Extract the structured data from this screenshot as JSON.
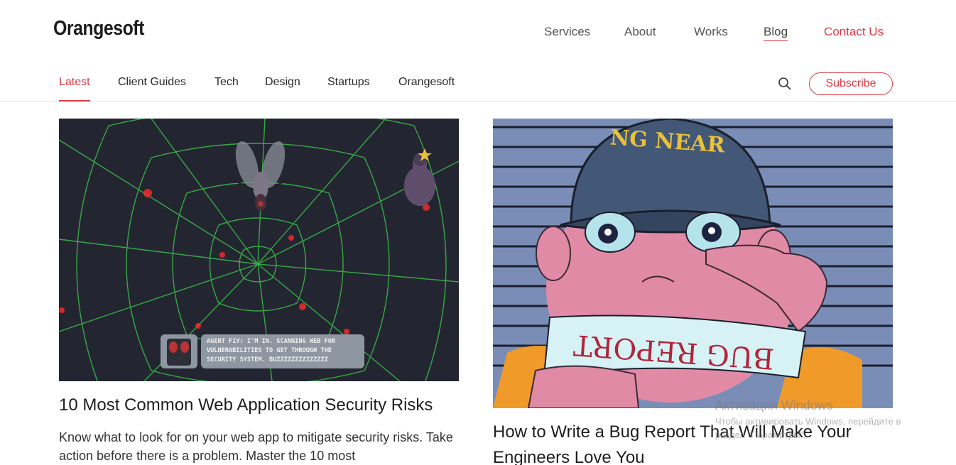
{
  "brand": {
    "name": "Orangesoft"
  },
  "main_nav": [
    {
      "label": "Services"
    },
    {
      "label": "About"
    },
    {
      "label": "Works"
    },
    {
      "label": "Blog",
      "active": true
    },
    {
      "label": "Contact Us"
    }
  ],
  "sub_nav": [
    {
      "label": "Latest",
      "active": true
    },
    {
      "label": "Client Guides"
    },
    {
      "label": "Tech"
    },
    {
      "label": "Design"
    },
    {
      "label": "Startups"
    },
    {
      "label": "Orangesoft"
    }
  ],
  "actions": {
    "search_icon": "search-icon",
    "subscribe_label": "Subscribe"
  },
  "colors": {
    "accent": "#e03a45",
    "text": "#222222",
    "divider": "#e4e4e4"
  },
  "articles": [
    {
      "title": "10 Most Common Web Application Security Risks",
      "excerpt": "Know what to look for on your web app to mitigate security risks. Take action before there is a problem. Master the 10 most",
      "image": {
        "speech": "AGENT F1Y: I'M IN. SCANNING WEB FOR VULNERABILITIES TO GET THROUGH THE SECURITY SYSTEM. BUZZZZZZZZZZZZZZ"
      }
    },
    {
      "title": "How to Write a Bug Report That Will Make Your Engineers Love You",
      "image": {
        "cap_text": "NG NEAR",
        "sign_text": "BUG REPORT"
      }
    }
  ],
  "watermark": {
    "line1": "Активация Windows",
    "line2": "Чтобы активировать Windows, перейдите в",
    "line3": "раздел \"Параметры\"."
  }
}
